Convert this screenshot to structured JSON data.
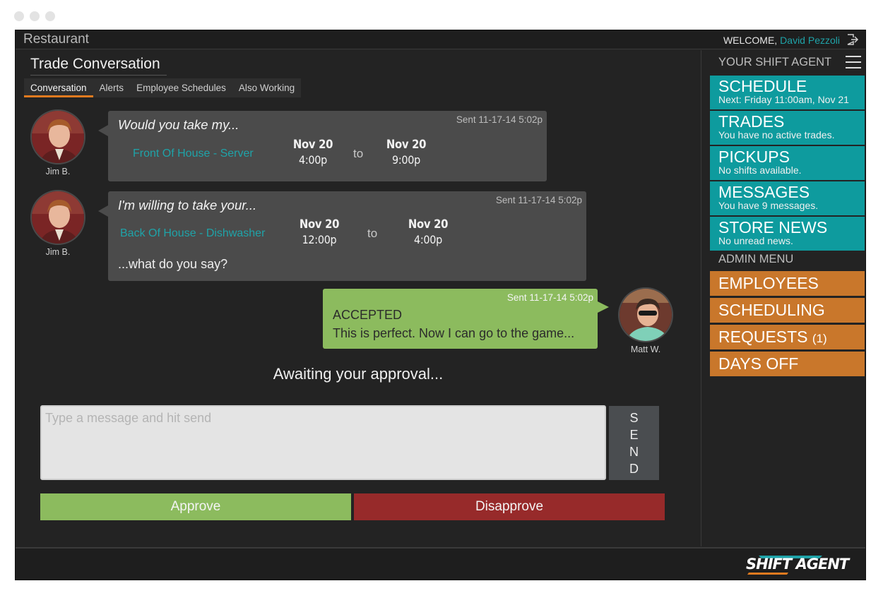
{
  "app_title": "Restaurant",
  "welcome": {
    "prefix": "WELCOME,",
    "user": "David Pezzoli"
  },
  "page_title": "Trade Conversation",
  "tabs": [
    {
      "label": "Conversation",
      "active": true
    },
    {
      "label": "Alerts",
      "active": false
    },
    {
      "label": "Employee Schedules",
      "active": false
    },
    {
      "label": "Also Working",
      "active": false
    }
  ],
  "messages": [
    {
      "sender": "Jim B.",
      "sent": "Sent 11-17-14 5:02p",
      "lead": "Would you take my...",
      "position": "Front Of House - Server",
      "start": {
        "date": "Nov 20",
        "time": "4:00p"
      },
      "to": "to",
      "end": {
        "date": "Nov 20",
        "time": "9:00p"
      }
    },
    {
      "sender": "Jim B.",
      "sent": "Sent 11-17-14 5:02p",
      "lead": "I'm willing to take your...",
      "position": "Back Of House - Dishwasher",
      "start": {
        "date": "Nov 20",
        "time": "12:00p"
      },
      "to": "to",
      "end": {
        "date": "Nov 20",
        "time": "4:00p"
      },
      "tail": "...what do you say?"
    },
    {
      "sender": "Matt W.",
      "sent": "Sent 11-17-14 5:02p",
      "status": "ACCEPTED",
      "text": "This is perfect. Now I can go to the game..."
    }
  ],
  "awaiting": "Awaiting your approval...",
  "compose": {
    "placeholder": "Type a message and hit send",
    "send_letters": [
      "S",
      "E",
      "N",
      "D"
    ]
  },
  "actions": {
    "approve": "Approve",
    "disapprove": "Disapprove"
  },
  "sidebar": {
    "header": "YOUR SHIFT AGENT",
    "items": [
      {
        "label": "SCHEDULE",
        "sub": "Next: Friday 11:00am, Nov 21"
      },
      {
        "label": "TRADES",
        "sub": "You have no active trades."
      },
      {
        "label": "PICKUPS",
        "sub": "No shifts available."
      },
      {
        "label": "MESSAGES",
        "sub": "You have 9 messages."
      },
      {
        "label": "STORE NEWS",
        "sub": "No unread news."
      }
    ],
    "admin_header": "ADMIN MENU",
    "admin_items": [
      {
        "label": "EMPLOYEES",
        "count": ""
      },
      {
        "label": "SCHEDULING",
        "count": ""
      },
      {
        "label": "REQUESTS",
        "count": "(1)"
      },
      {
        "label": "DAYS OFF",
        "count": ""
      }
    ]
  },
  "brand": "SHIFT AGENT",
  "colors": {
    "teal": "#0e9b9e",
    "orange": "#c9772b",
    "green": "#8cbb5e",
    "red": "#972a2a",
    "accent_tab": "#e07a1f"
  }
}
